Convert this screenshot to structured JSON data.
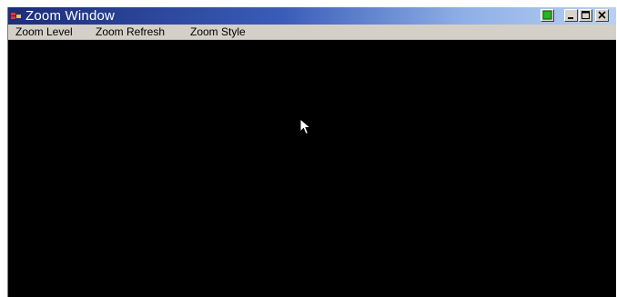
{
  "window": {
    "title": "Zoom Window",
    "app_icon": "zoom-app-icon",
    "controls": {
      "green_button": "green-square-icon",
      "minimize": "minimize-icon",
      "maximize": "maximize-icon",
      "close": "close-icon"
    }
  },
  "menu": {
    "items": [
      {
        "label": "Zoom Level"
      },
      {
        "label": "Zoom Refresh"
      },
      {
        "label": "Zoom Style"
      }
    ]
  },
  "canvas": {
    "background": "#000000",
    "cursor_icon": "arrow-cursor-icon"
  },
  "colors": {
    "titlebar_start": "#1c2d7a",
    "titlebar_end": "#b8d0f2",
    "menubar": "#d4d0c8",
    "indicator_green": "#22b822"
  }
}
